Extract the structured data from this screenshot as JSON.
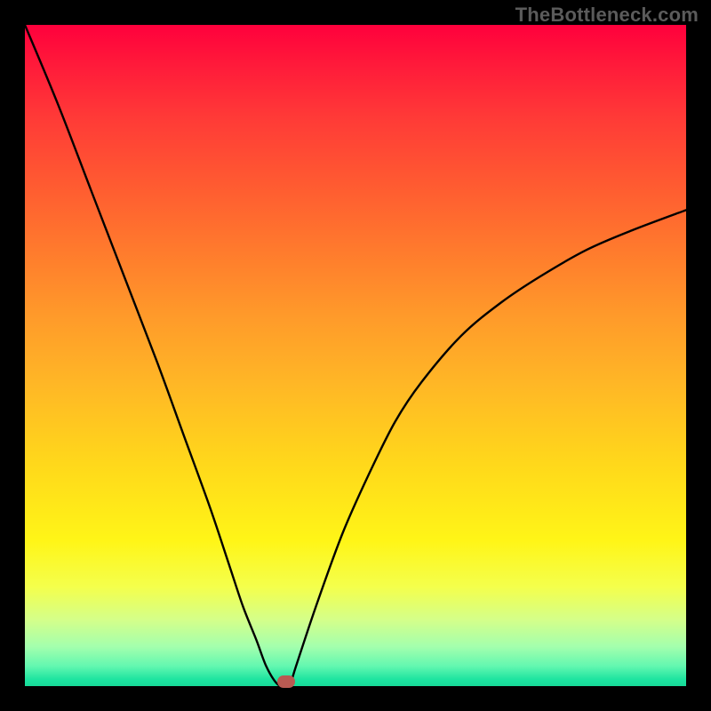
{
  "watermark": "TheBottleneck.com",
  "colors": {
    "frame": "#000000",
    "curve": "#000000",
    "marker": "#b95a52",
    "gradient_top": "#ff003c",
    "gradient_bottom": "#17da98"
  },
  "chart_data": {
    "type": "line",
    "title": "",
    "xlabel": "",
    "ylabel": "",
    "xlim": [
      0,
      100
    ],
    "ylim": [
      0,
      100
    ],
    "grid": false,
    "legend": false,
    "series": [
      {
        "name": "bottleneck-curve",
        "x": [
          0,
          5,
          10,
          15,
          20,
          24,
          28,
          31,
          33,
          35,
          36.5,
          38,
          39,
          40,
          41,
          44,
          48,
          52,
          56,
          60,
          66,
          72,
          78,
          85,
          92,
          100
        ],
        "values": [
          100,
          88,
          75,
          62,
          49,
          38,
          27,
          18,
          12,
          7,
          3,
          0.5,
          0,
          0,
          3,
          12,
          23,
          32,
          40,
          46,
          53,
          58,
          62,
          66,
          69,
          72
        ]
      }
    ],
    "annotations": [
      {
        "name": "min-marker",
        "x": 39.5,
        "y": 0
      }
    ]
  }
}
